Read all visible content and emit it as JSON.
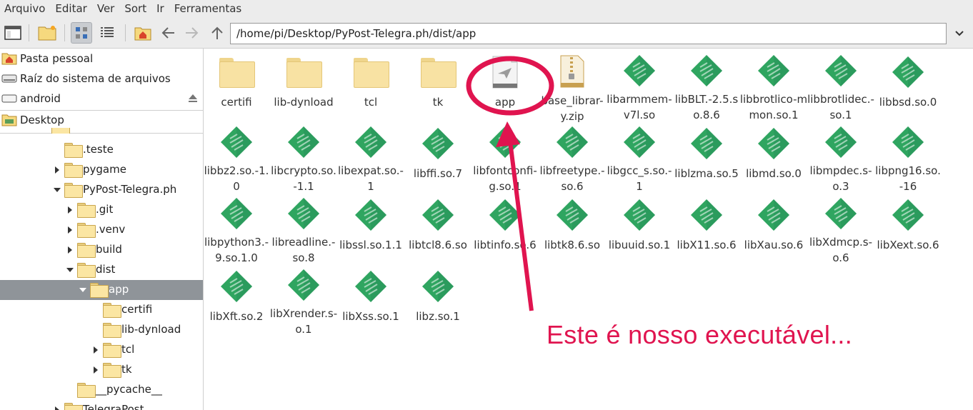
{
  "menubar": [
    "Arquivo",
    "Editar",
    "Ver",
    "Sort",
    "Ir",
    "Ferramentas"
  ],
  "toolbar": {
    "path": "/home/pi/Desktop/PyPost-Telegra.ph/dist/app"
  },
  "places": [
    {
      "label": "Pasta pessoal",
      "icon": "home-folder-icon"
    },
    {
      "label": "Raíz do sistema de arquivos",
      "icon": "drive-icon"
    },
    {
      "label": "android",
      "icon": "removable-drive-icon"
    },
    {
      "label": "Desktop",
      "icon": "desktop-folder-icon"
    }
  ],
  "tree": [
    {
      "label": ".teste"
    },
    {
      "label": "pygame"
    },
    {
      "label": "PyPost-Telegra.ph"
    },
    {
      "label": ".git"
    },
    {
      "label": ".venv"
    },
    {
      "label": "build"
    },
    {
      "label": "dist"
    },
    {
      "label": "app"
    },
    {
      "label": "certifi"
    },
    {
      "label": "lib-dynload"
    },
    {
      "label": "tcl"
    },
    {
      "label": "tk"
    },
    {
      "label": "__pycache__"
    },
    {
      "label": "TelegraPost"
    }
  ],
  "files": [
    {
      "name": "certifi",
      "type": "folder"
    },
    {
      "name": "lib-dynload",
      "type": "folder"
    },
    {
      "name": "tcl",
      "type": "folder"
    },
    {
      "name": "tk",
      "type": "folder"
    },
    {
      "name": "app",
      "type": "executable"
    },
    {
      "name": "base_librar-y.zip",
      "type": "zip"
    },
    {
      "name": "libarmmem-v7l.so",
      "type": "lib"
    },
    {
      "name": "libBLT.-2.5.so.8.6",
      "type": "lib"
    },
    {
      "name": "libbrotlico-mmon.so.1",
      "type": "lib"
    },
    {
      "name": "libbrotlidec.-so.1",
      "type": "lib"
    },
    {
      "name": "libbsd.so.0",
      "type": "lib"
    },
    {
      "name": "libbz2.so.-1.0",
      "type": "lib"
    },
    {
      "name": "libcrypto.so.-1.1",
      "type": "lib"
    },
    {
      "name": "libexpat.so.-1",
      "type": "lib"
    },
    {
      "name": "libffi.so.7",
      "type": "lib"
    },
    {
      "name": "libfontconfi-g.so.1",
      "type": "lib"
    },
    {
      "name": "libfreetype.-so.6",
      "type": "lib"
    },
    {
      "name": "libgcc_s.so.-1",
      "type": "lib"
    },
    {
      "name": "liblzma.so.5",
      "type": "lib"
    },
    {
      "name": "libmd.so.0",
      "type": "lib"
    },
    {
      "name": "libmpdec.s-o.3",
      "type": "lib"
    },
    {
      "name": "libpng16.so.-16",
      "type": "lib"
    },
    {
      "name": "libpython3.-9.so.1.0",
      "type": "lib"
    },
    {
      "name": "libreadline.-so.8",
      "type": "lib"
    },
    {
      "name": "libssl.so.1.1",
      "type": "lib"
    },
    {
      "name": "libtcl8.6.so",
      "type": "lib"
    },
    {
      "name": "libtinfo.so.6",
      "type": "lib"
    },
    {
      "name": "libtk8.6.so",
      "type": "lib"
    },
    {
      "name": "libuuid.so.1",
      "type": "lib"
    },
    {
      "name": "libX11.so.6",
      "type": "lib"
    },
    {
      "name": "libXau.so.6",
      "type": "lib"
    },
    {
      "name": "libXdmcp.s-o.6",
      "type": "lib"
    },
    {
      "name": "libXext.so.6",
      "type": "lib"
    },
    {
      "name": "libXft.so.2",
      "type": "lib"
    },
    {
      "name": "libXrender.s-o.1",
      "type": "lib"
    },
    {
      "name": "libXss.so.1",
      "type": "lib"
    },
    {
      "name": "libz.so.1",
      "type": "lib"
    }
  ],
  "annotation": {
    "text": "Este é nosso executável...",
    "color": "#e0144f"
  },
  "colors": {
    "lib_icon": "#2fa560",
    "selected_row": "#8f9499"
  }
}
